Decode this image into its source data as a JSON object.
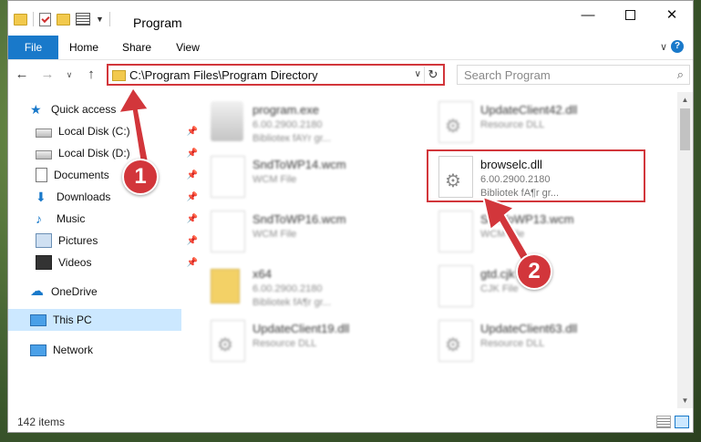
{
  "window": {
    "title": "Program",
    "colors": {
      "accent": "#1979ca",
      "annotation": "#d2363b",
      "selection": "#cce8ff"
    }
  },
  "ribbon": {
    "tabs": [
      "File",
      "Home",
      "Share",
      "View"
    ],
    "help_label": "?"
  },
  "address_bar": {
    "path": "C:\\Program Files\\Program Directory"
  },
  "search": {
    "placeholder": "Search Program"
  },
  "sidebar": {
    "items": [
      {
        "label": "Quick access",
        "icon": "star-icon"
      },
      {
        "label": "Local Disk (C:)",
        "icon": "drive-icon",
        "pinned": true
      },
      {
        "label": "Local Disk (D:)",
        "icon": "drive-icon",
        "pinned": true
      },
      {
        "label": "Documents",
        "icon": "document-icon",
        "pinned": true
      },
      {
        "label": "Downloads",
        "icon": "download-icon",
        "pinned": true
      },
      {
        "label": "Music",
        "icon": "music-icon",
        "pinned": true
      },
      {
        "label": "Pictures",
        "icon": "pictures-icon",
        "pinned": true
      },
      {
        "label": "Videos",
        "icon": "video-icon",
        "pinned": true
      },
      {
        "label": "OneDrive",
        "icon": "cloud-icon"
      },
      {
        "label": "This PC",
        "icon": "computer-icon",
        "selected": true
      },
      {
        "label": "Network",
        "icon": "network-icon"
      }
    ]
  },
  "files": [
    {
      "name": "program.exe",
      "line1": "6.00.2900.2180",
      "line2": "Biblioteк fAYr gr...",
      "icon": "exe-icon"
    },
    {
      "name": "UpdateClient42.dll",
      "line1": "Resource DLL",
      "line2": "",
      "icon": "dll-icon"
    },
    {
      "name": "SndToWP14.wcm",
      "line1": "WCM File",
      "line2": "",
      "icon": "file-icon"
    },
    {
      "name": "browselc.dll",
      "line1": "6.00.2900.2180",
      "line2": "Bibliotek fA¶r gr...",
      "icon": "dll-icon",
      "highlighted": true
    },
    {
      "name": "SndToWP16.wcm",
      "line1": "WCM File",
      "line2": "",
      "icon": "file-icon"
    },
    {
      "name": "SndToWP13.wcm",
      "line1": "WCM File",
      "line2": "",
      "icon": "file-icon"
    },
    {
      "name": "x64",
      "line1": "6.00.2900.2180",
      "line2": "Bibliotek fA¶r gr...",
      "icon": "folder-icon"
    },
    {
      "name": "gtd.cjk",
      "line1": "CJK File",
      "line2": "",
      "icon": "file-icon"
    },
    {
      "name": "UpdateClient19.dll",
      "line1": "Resource DLL",
      "line2": "",
      "icon": "dll-icon"
    },
    {
      "name": "UpdateClient63.dll",
      "line1": "Resource DLL",
      "line2": "",
      "icon": "dll-icon"
    }
  ],
  "status": {
    "item_count": "142 items"
  },
  "annotations": {
    "step1": "1",
    "step2": "2"
  }
}
